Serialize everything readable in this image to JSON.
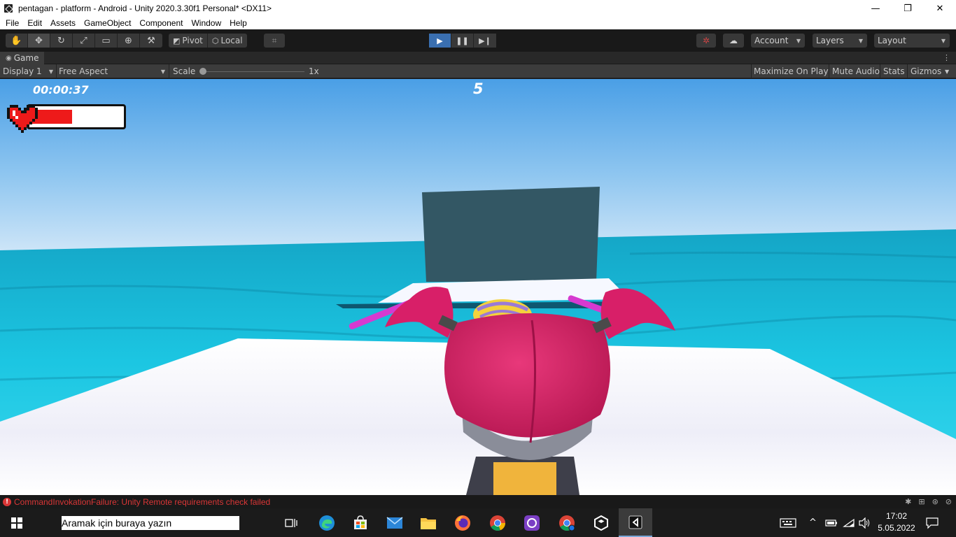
{
  "window": {
    "title": "pentagan - platform - Android - Unity 2020.3.30f1 Personal* <DX11>",
    "minimize": "—",
    "maximize": "❐",
    "close": "✕"
  },
  "menu": [
    "File",
    "Edit",
    "Assets",
    "GameObject",
    "Component",
    "Window",
    "Help"
  ],
  "toolbar": {
    "pivot_label": "Pivot",
    "local_label": "Local",
    "account_label": "Account",
    "layers_label": "Layers",
    "layout_label": "Layout"
  },
  "game_tab": {
    "label": "Game",
    "display": "Display 1",
    "aspect": "Free Aspect",
    "scale_label": "Scale",
    "scale_value": "1x",
    "maximize_on_play": "Maximize On Play",
    "mute_audio": "Mute Audio",
    "stats": "Stats",
    "gizmos": "Gizmos"
  },
  "hud": {
    "timer": "00:00:37",
    "score": "5",
    "health_fraction": 0.47
  },
  "status": {
    "message": "CommandInvokationFailure: Unity Remote requirements check failed"
  },
  "taskbar": {
    "search_placeholder": "Aramak için buraya yazın",
    "time": "17:02",
    "date": "5.05.2022"
  },
  "colors": {
    "sky_top": "#4aa0e6",
    "sea": "#1cc3e0",
    "character_pink": "#d81f68",
    "error_red": "#d93636",
    "health_red": "#ee1a1a"
  }
}
